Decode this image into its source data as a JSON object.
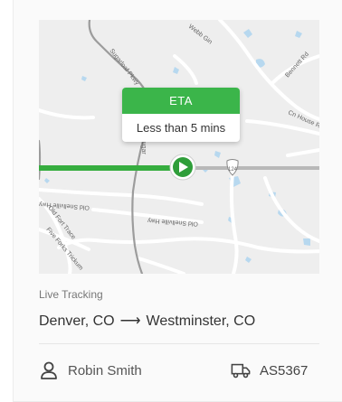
{
  "map": {
    "road_labels": [
      "Sugarloaf Pkwy",
      "Sugar",
      "Webb Gin",
      "Bennett Rd",
      "Cn House Rd",
      "Old Snellville Hwy",
      "Old Snellville Hwy",
      "Old Fort Trace",
      "Five Forks Trickum"
    ],
    "route_badge": "124",
    "colors": {
      "route_traveled": "#36ad3f",
      "route_remaining": "#b8b8b8",
      "water": "#b7d8ef",
      "road": "#ffffff",
      "accent": "#3bb54a"
    }
  },
  "eta": {
    "title": "ETA",
    "value": "Less than 5 mins"
  },
  "tracking": {
    "label": "Live Tracking",
    "origin": "Denver, CO",
    "arrow": "⟶",
    "destination": "Westminster, CO"
  },
  "driver": {
    "icon": "user-icon",
    "name": "Robin Smith"
  },
  "vehicle": {
    "icon": "truck-icon",
    "id": "AS5367"
  }
}
